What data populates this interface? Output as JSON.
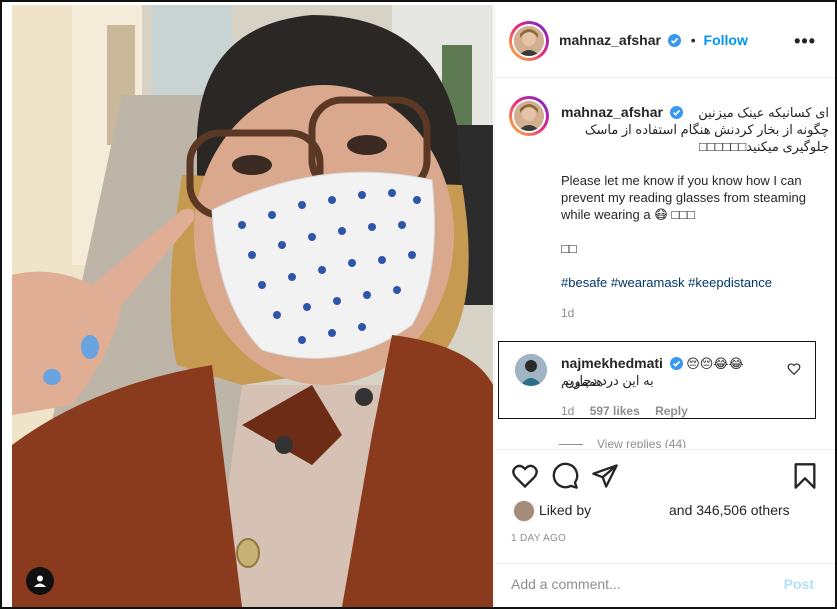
{
  "post": {
    "author": "mahnaz_afshar",
    "follow_label": "Follow",
    "separator": "•",
    "more_label": "•••"
  },
  "caption": {
    "username": "mahnaz_afshar",
    "persian_line1": "ای کسانیکه عینک میزنین",
    "persian_line2": "چگونه از بخار کردنش هنگام استفاده از ماسک",
    "persian_line3": "جلوگیری میکنید□□□□□□",
    "english": "Please let me know if you know how I can prevent my reading glasses from steaming while wearing a 😷 □□□",
    "boxes": "□□",
    "hashtags": "#besafe #wearamask #keepdistance",
    "time": "1d"
  },
  "comment": {
    "username": "najmekhedmati",
    "text_line1": "😂😂😔😔هممون",
    "text_line2": "به این درد دچاریم",
    "time": "1d",
    "likes": "597 likes",
    "reply_label": "Reply"
  },
  "view_replies": "View replies (44)",
  "likes": {
    "liked_by_label": "Liked by",
    "others_label": "and 346,506 others"
  },
  "date": "1 DAY AGO",
  "add_comment": {
    "placeholder": "Add a comment...",
    "post_label": "Post"
  },
  "colors": {
    "link_blue": "#0095f6",
    "hashtag": "#00376b",
    "muted": "#8e8e8e",
    "post_disabled": "#b2dffc",
    "verified": "#3897f0"
  },
  "icons": [
    "heart-icon",
    "comment-icon",
    "share-icon",
    "bookmark-icon",
    "verified-icon",
    "more-icon",
    "user-tag-icon"
  ]
}
